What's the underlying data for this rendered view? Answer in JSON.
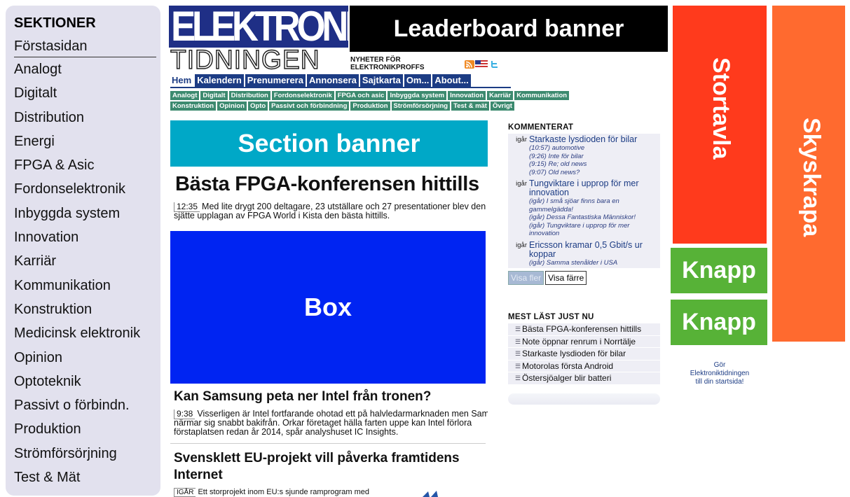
{
  "sidebar": {
    "heading": "SEKTIONER",
    "items": [
      "Förstasidan",
      "Analogt",
      "Digitalt",
      "Distribution",
      "Energi",
      "FPGA & Asic",
      "Fordonselektronik",
      "Inbyggda system",
      "Innovation",
      "Karriär",
      "Kommunikation",
      "Konstruktion",
      "Medicinsk elektronik",
      "Opinion",
      "Optoteknik",
      "Passivt o förbindn.",
      "Produktion",
      "Strömförsörjning",
      "Test & Mät"
    ]
  },
  "logo": {
    "top": "ELEKTRONIK",
    "bottom": "TIDNINGEN",
    "tagline_1": "NYHETER FÖR",
    "tagline_2": "ELEKTRONIKPROFFS"
  },
  "leaderboard": {
    "label": "Leaderboard banner"
  },
  "mainnav": [
    "Hem",
    "Kalendern",
    "Prenumerera",
    "Annonsera",
    "Sajtkarta",
    "Om...",
    "About..."
  ],
  "subnav": {
    "row1": [
      "Analogt",
      "Digitalt",
      "Distribution",
      "Fordonselektronik",
      "FPGA och asic",
      "Inbyggda system",
      "Innovation",
      "Karriär",
      "Kommunikation"
    ],
    "row2": [
      "Konstruktion",
      "Opinion",
      "Opto",
      "Passivt och förbindning",
      "Produktion",
      "Strömförsörjning",
      "Test & mät",
      "Övrigt"
    ]
  },
  "section_banner": {
    "label": "Section banner"
  },
  "articles": [
    {
      "headline": "Bästa FPGA-konferensen hittills",
      "time": "12:35",
      "line1": "Med lite drygt 200 deltagare, 23 utställare och 27 presentationer blev den",
      "line2": "sjätte upplagan av FPGA World i Kista den bästa hittills."
    },
    {
      "headline": "Kan Samsung peta ner Intel från tronen?",
      "time": "9:38",
      "line1": "Visserligen är Intel fortfarande ohotad ett på halvledarmarknaden men Samsu",
      "line2": "närmar sig snabbt bakifrån. Orkar företaget hälla farten uppe kan Intel förlora",
      "line3": "förstaplatsen redan år 2014, spår analyshuset IC Insights."
    },
    {
      "headline1": "Svensklett EU-projekt vill påverka framtidens",
      "headline2": "Internet",
      "time": "IGÅR",
      "line1": "Ett storprojekt inom EU:s sjunde ramprogram med"
    }
  ],
  "box": {
    "label": "Box"
  },
  "kommenterat": {
    "title": "KOMMENTERAT",
    "items": [
      {
        "when": "igår",
        "title": "Starkaste lysdioden för bilar",
        "subs": [
          "(10:57) automotive",
          "(9:26) Inte för bilar",
          "(9:15) Re; old news",
          "(9:07) Old news?"
        ]
      },
      {
        "when": "igår",
        "title": "Tungviktare i upprop för mer innovation",
        "subs": [
          "(igår) I små sjöar finns bara en gammelgädda!",
          "(igår) Dessa Fantastiska Människor!",
          "(igår) Tungviktare i upprop för mer innovation"
        ]
      },
      {
        "when": "igår",
        "title": "Ericsson kramar 0,5 Gbit/s ur koppar",
        "subs": [
          "(igår) Samma stenålder i USA"
        ]
      }
    ],
    "btn_more": "Visa fler",
    "btn_less": "Visa färre"
  },
  "mest": {
    "title": "MEST LÄST JUST NU",
    "items": [
      "Bästa FPGA-konferensen hittills",
      "Note öppnar renrum i Norrtälje",
      "Starkaste lysdioden för bilar",
      "Motorolas första Android",
      "Östersjöalger blir batteri"
    ]
  },
  "ads": {
    "stortavla": "Stortavla",
    "skyskrapa": "Skyskrapa",
    "knapp1": "Knapp",
    "knapp2": "Knapp"
  },
  "gor": {
    "line1": "Gör",
    "line2": "Elektroniktidningen",
    "line3": "till din startsida!"
  },
  "colors": {
    "nav_blue": "#1c3c84",
    "subnav_green": "#3c8a6f",
    "section_cyan": "#00a8c7",
    "box_blue": "#0024f2",
    "leaderboard": "#000000",
    "stortavla": "#ff3a1c",
    "skyskrapa": "#ff6a2f",
    "knapp": "#57b237"
  },
  "icons": [
    "rss-icon",
    "flag-icon",
    "twitter-icon"
  ]
}
